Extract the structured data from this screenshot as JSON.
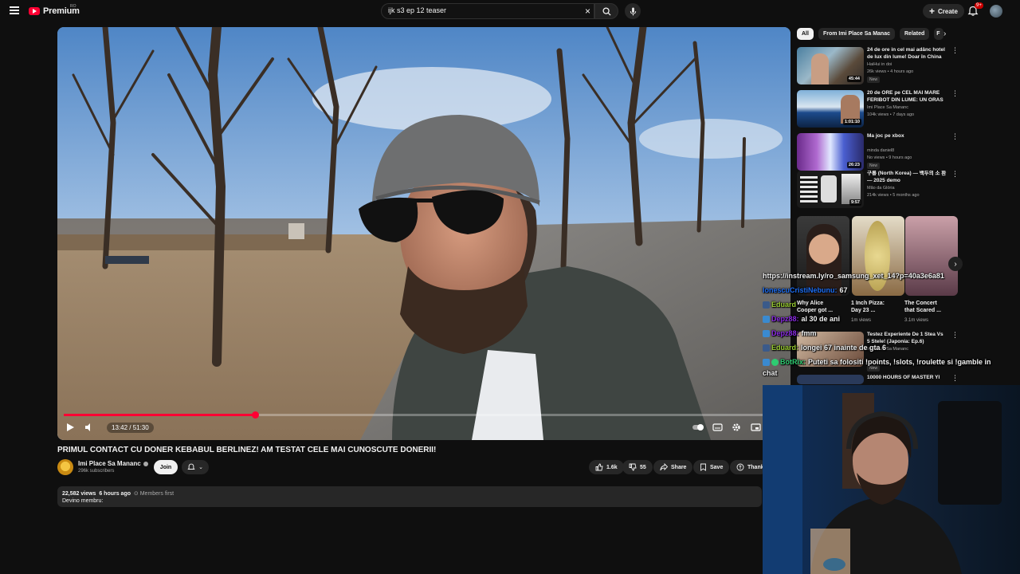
{
  "header": {
    "logo_text": "Premium",
    "region": "RO",
    "search_value": "ijk s3 ep 12 teaser",
    "create_label": "Create",
    "notification_count": "9+"
  },
  "player": {
    "time_label": "13:42 / 51:30",
    "progress_fraction": 0.266
  },
  "video": {
    "title": "PRIMUL CONTACT CU DONER KEBABUL BERLINEZ! AM TESTAT CELE MAI CUNOSCUTE DONERII!",
    "channel_name": "Imi Place Sa Mananc",
    "subscribers": "296k subscribers",
    "join_label": "Join",
    "likes": "1.6k",
    "dislikes": "55",
    "share_label": "Share",
    "save_label": "Save",
    "thanks_label": "Thank",
    "views": "22,582 views",
    "age": "6 hours ago",
    "members": "Members first",
    "desc_line": "Devino membru:"
  },
  "sidebar": {
    "chips": [
      "All",
      "From Imi Place Sa Manac",
      "Related",
      "F"
    ],
    "recommendations": [
      {
        "title": "24 de ore in cel mai adânc hotel de lux din lume! Doar în China ...",
        "channel": "HaiHui in doi",
        "stats": "26k views • 4 hours ago",
        "badge": "New",
        "duration": "45:44"
      },
      {
        "title": "20 de ORE pe CEL MAI MARE FERIBOT DIN LUME: UN ORAS ...",
        "channel": "Imi Place Sa Mananc",
        "stats": "104k views • 7 days ago",
        "badge": "",
        "duration": "1:01:10"
      },
      {
        "title": "Ma joc pe xbox",
        "channel": "minda daniel8",
        "stats": "No views • 9 hours ago",
        "badge": "New",
        "duration": "26:23"
      },
      {
        "title": "구룡 (North Korea) — 백두의 소 환 — 2025 demo",
        "channel": "Mão da Glória",
        "stats": "214k views • 5 months ago",
        "badge": "",
        "duration": "9:57"
      }
    ],
    "shorts": [
      {
        "title": "Why Alice Cooper got ...",
        "views": "1m views"
      },
      {
        "title": "1 Inch Pizza: Day 23 ...",
        "views": "1m views"
      },
      {
        "title": "The Concert that Scared ...",
        "views": "3.1m views"
      }
    ],
    "rec_after": [
      {
        "title": "Testez Experiente De 1 Stea Vs 5 Stele! (Japonia: Ep.6)",
        "channel": "Imi Place Sa Mananc",
        "stats": "",
        "badge": "New"
      },
      {
        "title": "10000 HOURS OF MASTER YI",
        "channel": "",
        "stats": "",
        "badge": ""
      }
    ]
  },
  "chat": {
    "lines": [
      {
        "user": "",
        "text": "https://instream.ly/ro_samsung_xet_14?p=40a3e6a81",
        "color": "#ffffff"
      },
      {
        "user": "IonescuCristiNebunu:",
        "text": "67",
        "color": "#1e6ff5"
      },
      {
        "user": "Eduard",
        "text": "",
        "color": "#9acd32"
      },
      {
        "user": "Depz88:",
        "text": "al 30 de ani",
        "color": "#8a2be2"
      },
      {
        "user": "Depz88:",
        "text": "fmm",
        "color": "#8a2be2"
      },
      {
        "user": "Eduard:",
        "text": "longei 67 inainte de gta 6",
        "color": "#9acd32"
      },
      {
        "user": "BotRix:",
        "text": "Puteti sa folositi !points, !slots, !roulette si !gamble in",
        "color": "#2ecc71"
      },
      {
        "user": "",
        "text": "chat",
        "color": "#ffffff"
      }
    ]
  },
  "colors": {
    "accent": "#ff0033",
    "background": "#0f0f0f",
    "chip_bg": "#272727"
  },
  "icons": [
    "menu-icon",
    "youtube-logo-icon",
    "search-icon",
    "mic-icon",
    "plus-icon",
    "bell-icon",
    "play-icon",
    "volume-icon",
    "settings-icon",
    "captions-icon",
    "autoplay-icon",
    "like-icon",
    "dislike-icon",
    "share-icon",
    "save-icon",
    "thanks-icon",
    "more-vert-icon",
    "chevron-right-icon"
  ]
}
